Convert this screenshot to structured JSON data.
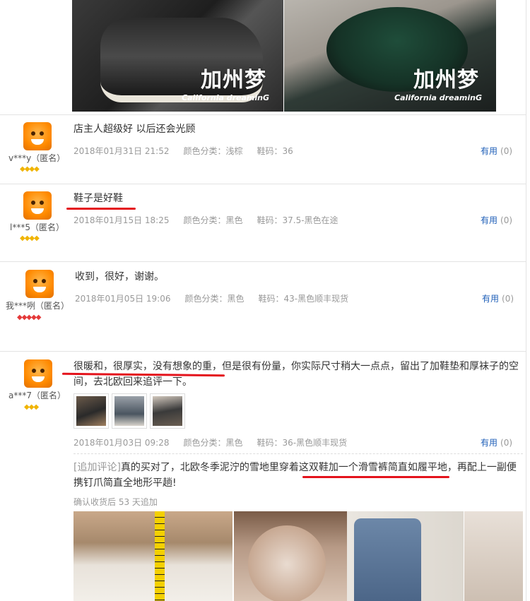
{
  "top_photos": [
    {
      "watermark_cn": "加州梦",
      "watermark_en": "California dreaminG"
    },
    {
      "watermark_cn": "加州梦",
      "watermark_en": "California dreaminG"
    }
  ],
  "useful_label": "有用",
  "reviews": [
    {
      "user": "v***y（匿名）",
      "gems": "◆◆◆◆",
      "gem_color": "#f0b400",
      "gem_count": 4,
      "text": "店主人超级好 以后还会光顾",
      "date": "2018年01月31日 21:52",
      "color": "颜色分类：浅棕",
      "size": "鞋码：36",
      "useful_count": "(0)"
    },
    {
      "user": "l***5（匿名）",
      "gems": "◆◆◆◆",
      "gem_color": "#f0b400",
      "gem_count": 4,
      "text": "鞋子是好鞋",
      "date": "2018年01月15日 18:25",
      "color": "颜色分类：黑色",
      "size": "鞋码：37.5-黑色在途",
      "useful_count": "(0)"
    },
    {
      "user": "我***咧（匿名）",
      "gems": "◆◆◆◆◆",
      "gem_color": "#e43a3a",
      "gem_count": 5,
      "text": "收到，很好，谢谢。",
      "date": "2018年01月05日 19:06",
      "color": "颜色分类：黑色",
      "size": "鞋码：43-黑色顺丰现货",
      "useful_count": "(0)"
    },
    {
      "user": "a***7（匿名）",
      "gems": "◆◆◆",
      "gem_color": "#f0b400",
      "gem_count": 3,
      "text": "很暖和，很厚实，没有想象的重，但是很有份量，你实际尺寸稍大一点点，留出了加鞋垫和厚袜子的空间，去北欧回来追评一下。",
      "date": "2018年01月03日 09:28",
      "color": "颜色分类：黑色",
      "size": "鞋码：36-黑色顺丰现货",
      "useful_count": "(0)",
      "append_tag": "[追加评论]",
      "append_text": "真的买对了，北欧冬季泥泞的雪地里穿着这双鞋加一个滑雪裤简直如履平地，再配上一副便携钉爪简直全地形平趟!",
      "append_note": "确认收货后 53 天追加"
    }
  ]
}
